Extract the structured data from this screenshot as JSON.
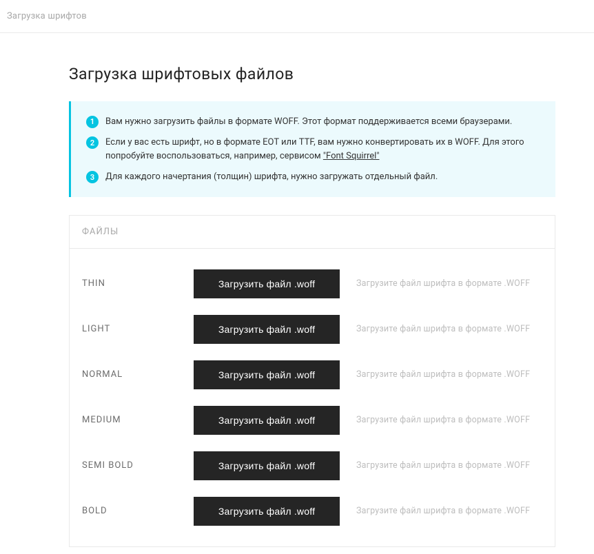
{
  "topbar": {
    "title": "Загрузка шрифтов"
  },
  "page": {
    "title": "Загрузка шрифтовых файлов"
  },
  "info": {
    "items": [
      {
        "num": "1",
        "text_before": "Вам нужно загрузить файлы в формате WOFF. Этот формат поддерживается всеми браузерами.",
        "link": "",
        "text_after": ""
      },
      {
        "num": "2",
        "text_before": "Если у вас есть шрифт, но в формате EOT или TTF, вам нужно конвертировать их в WOFF. Для этого попробуйте воспользоваться, например, сервисом ",
        "link": "\"Font Squirrel\"",
        "text_after": ""
      },
      {
        "num": "3",
        "text_before": "Для каждого начертания (толщин) шрифта, нужно загружать отдельный файл.",
        "link": "",
        "text_after": ""
      }
    ]
  },
  "files": {
    "header": "ФАЙЛЫ",
    "button_label": "Загрузить файл .woff",
    "hint": "Загрузите файл шрифта в формате .WOFF",
    "weights": [
      {
        "label": "THIN"
      },
      {
        "label": "LIGHT"
      },
      {
        "label": "NORMAL"
      },
      {
        "label": "MEDIUM"
      },
      {
        "label": "SEMI BOLD"
      },
      {
        "label": "BOLD"
      }
    ]
  }
}
